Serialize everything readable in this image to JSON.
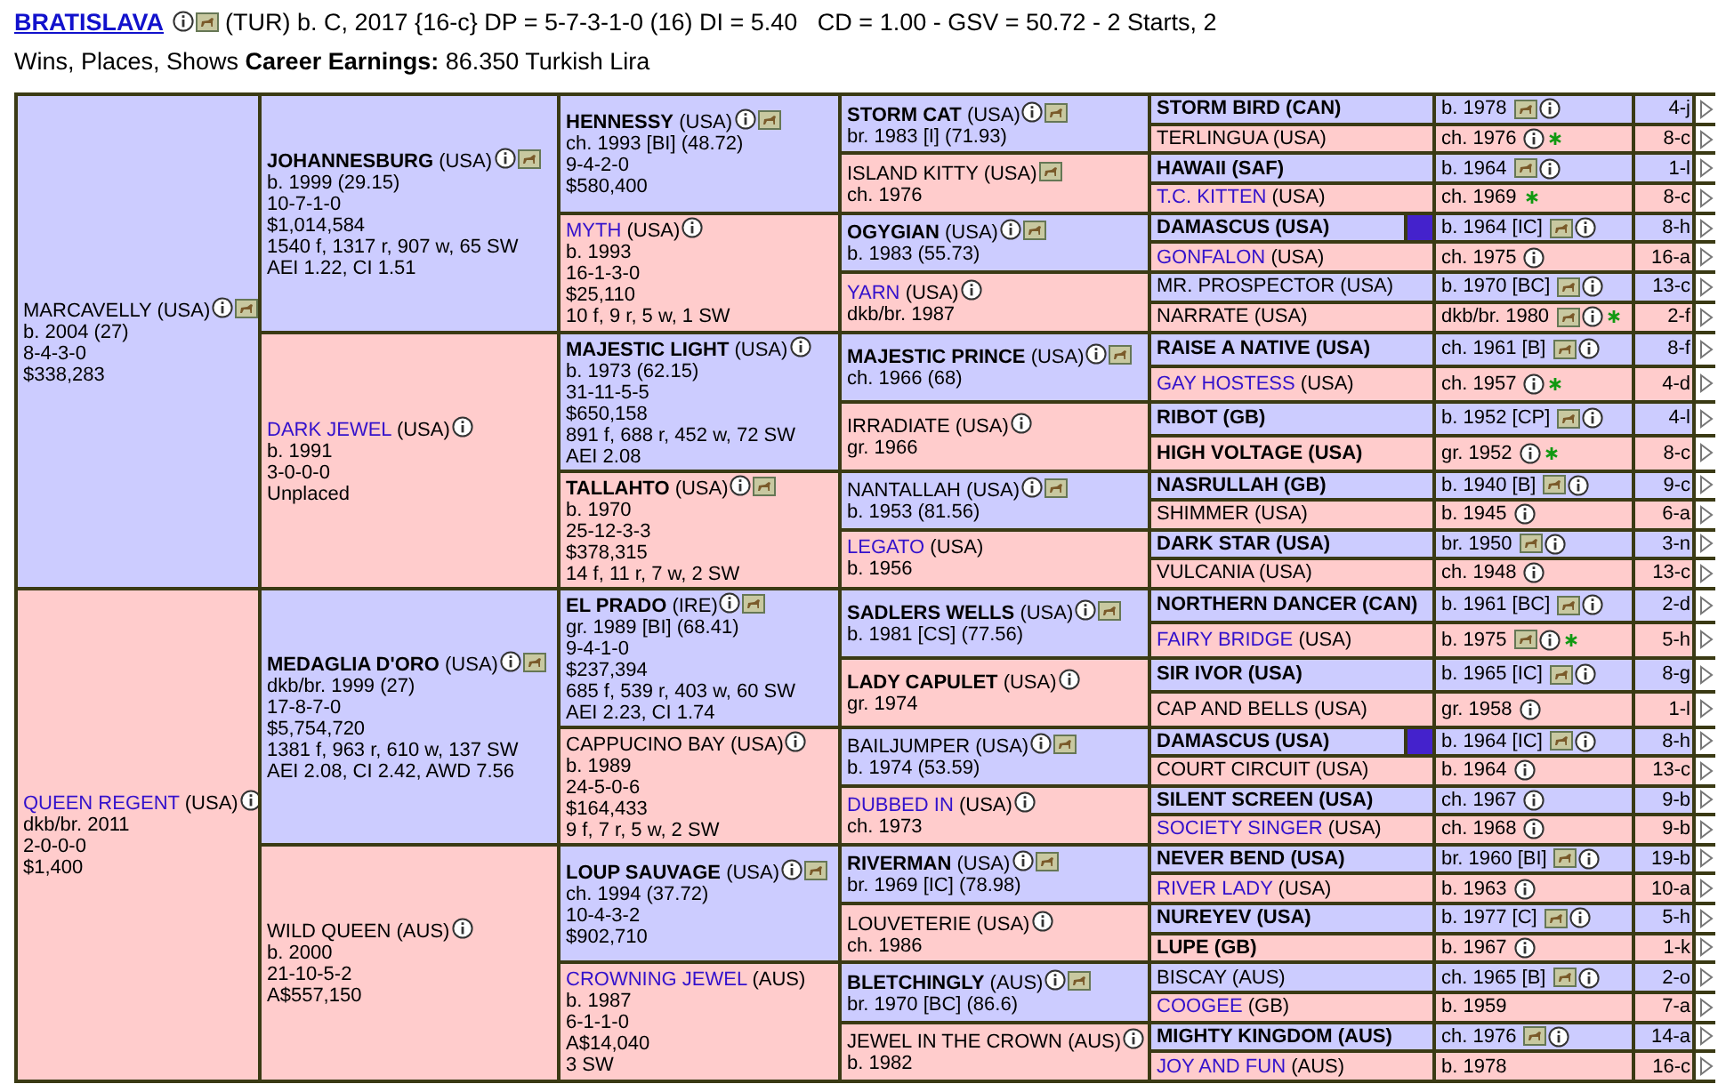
{
  "horse": {
    "name": "BRATISLAVA",
    "info": true,
    "photo": true,
    "summary": "(TUR) b. C, 2017 {16-c} DP = 5-7-3-1-0 (16) DI = 5.40   CD = 1.00 - GSV = 50.72 - 2 Starts, 2 Wins, Places, Shows **Career Earnings:** 86.350 Turkish Lira"
  },
  "pedigree": [
    {
      "name": "MARCAVELLY",
      "country": "(USA)",
      "bold": false,
      "linked": false,
      "info": true,
      "photo": true,
      "lines": [
        "b. 2004 (27)",
        "8-4-3-0",
        "$338,283"
      ],
      "children": [
        {
          "name": "JOHANNESBURG",
          "country": "(USA)",
          "bold": true,
          "linked": false,
          "info": true,
          "photo": true,
          "lines": [
            "b. 1999 (29.15)",
            "10-7-1-0",
            "$1,014,584",
            "1540 f, 1317 r, 907 w, 65 SW",
            "AEI 1.22, CI 1.51"
          ],
          "children": [
            {
              "name": "HENNESSY",
              "country": "(USA)",
              "bold": true,
              "linked": false,
              "info": true,
              "photo": true,
              "lines": [
                "ch. 1993 [BI] (48.72)",
                "9-4-2-0",
                "$580,400"
              ],
              "children": [
                {
                  "name": "STORM CAT",
                  "country": "(USA)",
                  "bold": true,
                  "linked": false,
                  "info": true,
                  "photo": true,
                  "lines": [
                    "br. 1983 [I] (71.93)"
                  ],
                  "children": [
                    {
                      "name": "STORM BIRD",
                      "country": "(CAN)",
                      "bold": true,
                      "linked": false,
                      "highlighted": false,
                      "detail": "b. 1978",
                      "photo": true,
                      "info": true,
                      "family": "4-j"
                    },
                    {
                      "name": "TERLINGUA",
                      "country": "(USA)",
                      "bold": false,
                      "linked": false,
                      "highlighted": false,
                      "detail": "ch. 1976",
                      "info": true,
                      "star": true,
                      "family": "8-c"
                    }
                  ]
                },
                {
                  "name": "ISLAND KITTY",
                  "country": "(USA)",
                  "bold": false,
                  "linked": false,
                  "photo": true,
                  "lines": [
                    "ch. 1976"
                  ],
                  "children": [
                    {
                      "name": "HAWAII",
                      "country": "(SAF)",
                      "bold": true,
                      "linked": false,
                      "highlighted": false,
                      "detail": "b. 1964",
                      "photo": true,
                      "info": true,
                      "family": "1-l"
                    },
                    {
                      "name": "T.C. KITTEN",
                      "country": "(USA)",
                      "bold": false,
                      "linked": true,
                      "highlighted": false,
                      "detail": "ch. 1969",
                      "star": true,
                      "family": "8-c"
                    }
                  ]
                }
              ]
            },
            {
              "name": "MYTH",
              "country": "(USA)",
              "bold": false,
              "linked": true,
              "info": true,
              "lines": [
                "b. 1993",
                "16-1-3-0",
                "$25,110",
                "10 f, 9 r, 5 w, 1 SW"
              ],
              "children": [
                {
                  "name": "OGYGIAN",
                  "country": "(USA)",
                  "bold": true,
                  "linked": false,
                  "info": true,
                  "photo": true,
                  "lines": [
                    "b. 1983 (55.73)"
                  ],
                  "children": [
                    {
                      "name": "DAMASCUS",
                      "country": "(USA)",
                      "bold": true,
                      "linked": false,
                      "highlighted": true,
                      "detail": "b. 1964 [IC]",
                      "photo": true,
                      "info": true,
                      "family": "8-h"
                    },
                    {
                      "name": "GONFALON",
                      "country": "(USA)",
                      "bold": false,
                      "linked": true,
                      "highlighted": false,
                      "detail": "ch. 1975",
                      "info": true,
                      "family": "16-a"
                    }
                  ]
                },
                {
                  "name": "YARN",
                  "country": "(USA)",
                  "bold": false,
                  "linked": true,
                  "info": true,
                  "lines": [
                    "dkb/br. 1987"
                  ],
                  "children": [
                    {
                      "name": "MR. PROSPECTOR",
                      "country": "(USA)",
                      "bold": false,
                      "linked": false,
                      "highlighted": false,
                      "detail": "b. 1970 [BC]",
                      "photo": true,
                      "info": true,
                      "family": "13-c"
                    },
                    {
                      "name": "NARRATE",
                      "country": "(USA)",
                      "bold": false,
                      "linked": false,
                      "highlighted": false,
                      "detail": "dkb/br. 1980",
                      "photo": true,
                      "info": true,
                      "star": true,
                      "family": "2-f"
                    }
                  ]
                }
              ]
            }
          ]
        },
        {
          "name": "DARK JEWEL",
          "country": "(USA)",
          "bold": false,
          "linked": true,
          "info": true,
          "lines": [
            "b. 1991",
            "3-0-0-0",
            "Unplaced"
          ],
          "children": [
            {
              "name": "MAJESTIC LIGHT",
              "country": "(USA)",
              "bold": true,
              "linked": false,
              "info": true,
              "lines": [
                "b. 1973 (62.15)",
                "31-11-5-5",
                "$650,158",
                "891 f, 688 r, 452 w, 72 SW",
                "AEI 2.08"
              ],
              "children": [
                {
                  "name": "MAJESTIC PRINCE",
                  "country": "(USA)",
                  "bold": true,
                  "linked": false,
                  "info": true,
                  "photo": true,
                  "lines": [
                    "ch. 1966 (68)"
                  ],
                  "children": [
                    {
                      "name": "RAISE A NATIVE",
                      "country": "(USA)",
                      "bold": true,
                      "linked": false,
                      "highlighted": false,
                      "detail": "ch. 1961 [B]",
                      "photo": true,
                      "info": true,
                      "family": "8-f"
                    },
                    {
                      "name": "GAY HOSTESS",
                      "country": "(USA)",
                      "bold": false,
                      "linked": true,
                      "highlighted": false,
                      "detail": "ch. 1957",
                      "info": true,
                      "star": true,
                      "family": "4-d"
                    }
                  ]
                },
                {
                  "name": "IRRADIATE",
                  "country": "(USA)",
                  "bold": false,
                  "linked": false,
                  "info": true,
                  "lines": [
                    "gr. 1966"
                  ],
                  "children": [
                    {
                      "name": "RIBOT",
                      "country": "(GB)",
                      "bold": true,
                      "linked": false,
                      "highlighted": false,
                      "detail": "b. 1952 [CP]",
                      "photo": true,
                      "info": true,
                      "family": "4-l"
                    },
                    {
                      "name": "HIGH VOLTAGE",
                      "country": "(USA)",
                      "bold": true,
                      "linked": false,
                      "highlighted": false,
                      "detail": "gr. 1952",
                      "info": true,
                      "star": true,
                      "family": "8-c"
                    }
                  ]
                }
              ]
            },
            {
              "name": "TALLAHTO",
              "country": "(USA)",
              "bold": true,
              "linked": false,
              "info": true,
              "photo": true,
              "lines": [
                "b. 1970",
                "25-12-3-3",
                "$378,315",
                "14 f, 11 r, 7 w, 2 SW"
              ],
              "children": [
                {
                  "name": "NANTALLAH",
                  "country": "(USA)",
                  "bold": false,
                  "linked": false,
                  "info": true,
                  "photo": true,
                  "lines": [
                    "b. 1953 (81.56)"
                  ],
                  "children": [
                    {
                      "name": "NASRULLAH",
                      "country": "(GB)",
                      "bold": true,
                      "linked": false,
                      "highlighted": false,
                      "detail": "b. 1940 [B]",
                      "photo": true,
                      "info": true,
                      "family": "9-c"
                    },
                    {
                      "name": "SHIMMER",
                      "country": "(USA)",
                      "bold": false,
                      "linked": false,
                      "highlighted": false,
                      "detail": "b. 1945",
                      "info": true,
                      "family": "6-a"
                    }
                  ]
                },
                {
                  "name": "LEGATO",
                  "country": "(USA)",
                  "bold": false,
                  "linked": true,
                  "lines": [
                    "b. 1956"
                  ],
                  "children": [
                    {
                      "name": "DARK STAR",
                      "country": "(USA)",
                      "bold": true,
                      "linked": false,
                      "highlighted": false,
                      "detail": "br. 1950",
                      "photo": true,
                      "info": true,
                      "family": "3-n"
                    },
                    {
                      "name": "VULCANIA",
                      "country": "(USA)",
                      "bold": false,
                      "linked": false,
                      "highlighted": false,
                      "detail": "ch. 1948",
                      "info": true,
                      "family": "13-c"
                    }
                  ]
                }
              ]
            }
          ]
        }
      ]
    },
    {
      "name": "QUEEN REGENT",
      "country": "(USA)",
      "bold": false,
      "linked": true,
      "info": true,
      "lines": [
        "dkb/br. 2011",
        "2-0-0-0",
        "$1,400"
      ],
      "children": [
        {
          "name": "MEDAGLIA D'ORO",
          "country": "(USA)",
          "bold": true,
          "linked": false,
          "info": true,
          "photo": true,
          "lines": [
            "dkb/br. 1999 (27)",
            "17-8-7-0",
            "$5,754,720",
            "1381 f, 963 r, 610 w, 137 SW",
            "AEI 2.08, CI 2.42, AWD 7.56"
          ],
          "children": [
            {
              "name": "EL PRADO",
              "country": "(IRE)",
              "bold": true,
              "linked": false,
              "info": true,
              "photo": true,
              "lines": [
                "gr. 1989 [BI] (68.41)",
                "9-4-1-0",
                "$237,394",
                "685 f, 539 r, 403 w, 60 SW",
                "AEI 2.23, CI 1.74"
              ],
              "children": [
                {
                  "name": "SADLERS WELLS",
                  "country": "(USA)",
                  "bold": true,
                  "linked": false,
                  "info": true,
                  "photo": true,
                  "lines": [
                    "b. 1981 [CS] (77.56)"
                  ],
                  "children": [
                    {
                      "name": "NORTHERN DANCER",
                      "country": "(CAN)",
                      "bold": true,
                      "linked": false,
                      "highlighted": false,
                      "detail": "b. 1961 [BC]",
                      "photo": true,
                      "info": true,
                      "family": "2-d"
                    },
                    {
                      "name": "FAIRY BRIDGE",
                      "country": "(USA)",
                      "bold": false,
                      "linked": true,
                      "highlighted": false,
                      "detail": "b. 1975",
                      "photo": true,
                      "info": true,
                      "star": true,
                      "family": "5-h"
                    }
                  ]
                },
                {
                  "name": "LADY CAPULET",
                  "country": "(USA)",
                  "bold": true,
                  "linked": false,
                  "info": true,
                  "lines": [
                    "gr. 1974"
                  ],
                  "children": [
                    {
                      "name": "SIR IVOR",
                      "country": "(USA)",
                      "bold": true,
                      "linked": false,
                      "highlighted": false,
                      "detail": "b. 1965 [IC]",
                      "photo": true,
                      "info": true,
                      "family": "8-g"
                    },
                    {
                      "name": "CAP AND BELLS",
                      "country": "(USA)",
                      "bold": false,
                      "linked": false,
                      "highlighted": false,
                      "detail": "gr. 1958",
                      "info": true,
                      "family": "1-l"
                    }
                  ]
                }
              ]
            },
            {
              "name": "CAPPUCINO BAY",
              "country": "(USA)",
              "bold": false,
              "linked": false,
              "info": true,
              "lines": [
                "b. 1989",
                "24-5-0-6",
                "$164,433",
                "9 f, 7 r, 5 w, 2 SW"
              ],
              "children": [
                {
                  "name": "BAILJUMPER",
                  "country": "(USA)",
                  "bold": false,
                  "linked": false,
                  "info": true,
                  "photo": true,
                  "lines": [
                    "b. 1974 (53.59)"
                  ],
                  "children": [
                    {
                      "name": "DAMASCUS",
                      "country": "(USA)",
                      "bold": true,
                      "linked": false,
                      "highlighted": true,
                      "detail": "b. 1964 [IC]",
                      "photo": true,
                      "info": true,
                      "family": "8-h"
                    },
                    {
                      "name": "COURT CIRCUIT",
                      "country": "(USA)",
                      "bold": false,
                      "linked": false,
                      "highlighted": false,
                      "detail": "b. 1964",
                      "info": true,
                      "family": "13-c"
                    }
                  ]
                },
                {
                  "name": "DUBBED IN",
                  "country": "(USA)",
                  "bold": false,
                  "linked": true,
                  "info": true,
                  "lines": [
                    "ch. 1973"
                  ],
                  "children": [
                    {
                      "name": "SILENT SCREEN",
                      "country": "(USA)",
                      "bold": true,
                      "linked": false,
                      "highlighted": false,
                      "detail": "ch. 1967",
                      "info": true,
                      "family": "9-b"
                    },
                    {
                      "name": "SOCIETY SINGER",
                      "country": "(USA)",
                      "bold": false,
                      "linked": true,
                      "highlighted": false,
                      "detail": "ch. 1968",
                      "info": true,
                      "family": "9-b"
                    }
                  ]
                }
              ]
            }
          ]
        },
        {
          "name": "WILD QUEEN",
          "country": "(AUS)",
          "bold": false,
          "linked": false,
          "info": true,
          "lines": [
            "b. 2000",
            "21-10-5-2",
            "A$557,150"
          ],
          "children": [
            {
              "name": "LOUP SAUVAGE",
              "country": "(USA)",
              "bold": true,
              "linked": false,
              "info": true,
              "photo": true,
              "lines": [
                "ch. 1994 (37.72)",
                "10-4-3-2",
                "$902,710"
              ],
              "children": [
                {
                  "name": "RIVERMAN",
                  "country": "(USA)",
                  "bold": true,
                  "linked": false,
                  "info": true,
                  "photo": true,
                  "lines": [
                    "br. 1969 [IC] (78.98)"
                  ],
                  "children": [
                    {
                      "name": "NEVER BEND",
                      "country": "(USA)",
                      "bold": true,
                      "linked": false,
                      "highlighted": false,
                      "detail": "br. 1960 [BI]",
                      "photo": true,
                      "info": true,
                      "family": "19-b"
                    },
                    {
                      "name": "RIVER LADY",
                      "country": "(USA)",
                      "bold": false,
                      "linked": true,
                      "highlighted": false,
                      "detail": "b. 1963",
                      "info": true,
                      "family": "10-a"
                    }
                  ]
                },
                {
                  "name": "LOUVETERIE",
                  "country": "(USA)",
                  "bold": false,
                  "linked": false,
                  "info": true,
                  "lines": [
                    "ch. 1986"
                  ],
                  "children": [
                    {
                      "name": "NUREYEV",
                      "country": "(USA)",
                      "bold": true,
                      "linked": false,
                      "highlighted": false,
                      "detail": "b. 1977 [C]",
                      "photo": true,
                      "info": true,
                      "family": "5-h"
                    },
                    {
                      "name": "LUPE",
                      "country": "(GB)",
                      "bold": true,
                      "linked": false,
                      "highlighted": false,
                      "detail": "b. 1967",
                      "info": true,
                      "family": "1-k"
                    }
                  ]
                }
              ]
            },
            {
              "name": "CROWNING JEWEL",
              "country": "(AUS)",
              "bold": false,
              "linked": true,
              "lines": [
                "b. 1987",
                "6-1-1-0",
                "A$14,040",
                "3 SW"
              ],
              "children": [
                {
                  "name": "BLETCHINGLY",
                  "country": "(AUS)",
                  "bold": true,
                  "linked": false,
                  "info": true,
                  "photo": true,
                  "lines": [
                    "br. 1970 [BC] (86.6)"
                  ],
                  "children": [
                    {
                      "name": "BISCAY",
                      "country": "(AUS)",
                      "bold": false,
                      "linked": false,
                      "highlighted": false,
                      "detail": "ch. 1965 [B]",
                      "photo": true,
                      "info": true,
                      "family": "2-o"
                    },
                    {
                      "name": "COOGEE",
                      "country": "(GB)",
                      "bold": false,
                      "linked": true,
                      "highlighted": false,
                      "detail": "b. 1959",
                      "family": "7-a"
                    }
                  ]
                },
                {
                  "name": "JEWEL IN THE CROWN",
                  "country": "(AUS)",
                  "bold": false,
                  "linked": false,
                  "info": true,
                  "lines": [
                    "b. 1982"
                  ],
                  "children": [
                    {
                      "name": "MIGHTY KINGDOM",
                      "country": "(AUS)",
                      "bold": true,
                      "linked": false,
                      "highlighted": false,
                      "detail": "ch. 1976",
                      "photo": true,
                      "info": true,
                      "family": "14-a"
                    },
                    {
                      "name": "JOY AND FUN",
                      "country": "(AUS)",
                      "bold": false,
                      "linked": true,
                      "highlighted": false,
                      "detail": "b. 1978",
                      "family": "16-c"
                    }
                  ]
                }
              ]
            }
          ]
        }
      ]
    }
  ]
}
